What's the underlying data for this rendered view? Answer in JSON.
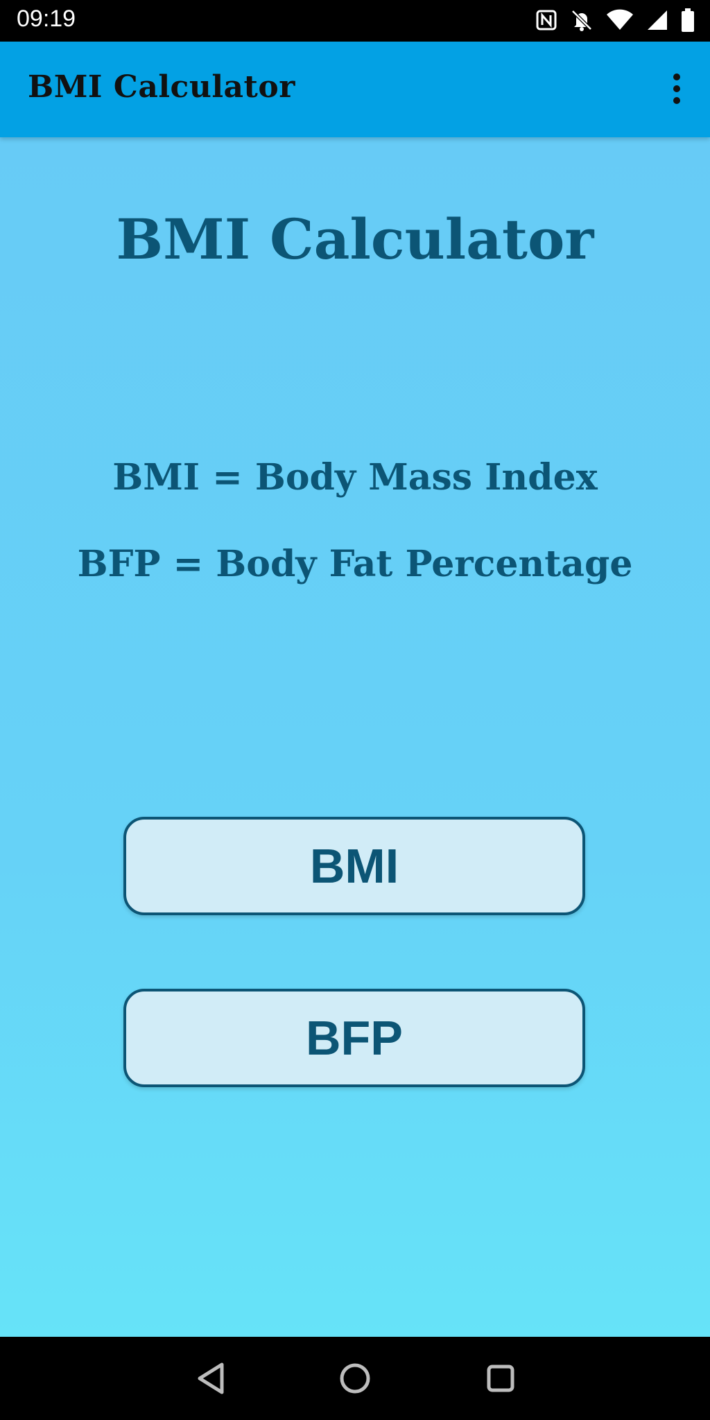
{
  "status_bar": {
    "time": "09:19",
    "icons": [
      "nfc-icon",
      "notifications-off-icon",
      "wifi-icon",
      "cellular-signal-icon",
      "battery-icon"
    ]
  },
  "app_bar": {
    "title": "BMI Calculator",
    "menu_icon": "more-vert-icon"
  },
  "main": {
    "heading": "BMI Calculator",
    "definition_bmi": "BMI = Body Mass Index",
    "definition_bfp": "BFP = Body Fat Percentage",
    "buttons": [
      {
        "label": "BMI"
      },
      {
        "label": "BFP"
      }
    ]
  },
  "nav_bar": {
    "icons": [
      "back-icon",
      "home-icon",
      "recents-icon"
    ]
  },
  "colors": {
    "app_bar": "#03a1e4",
    "background_top": "#67cbf6",
    "background_bottom": "#66e3f8",
    "text_primary": "#0c5575",
    "button_fill": "#d1ecf7"
  }
}
